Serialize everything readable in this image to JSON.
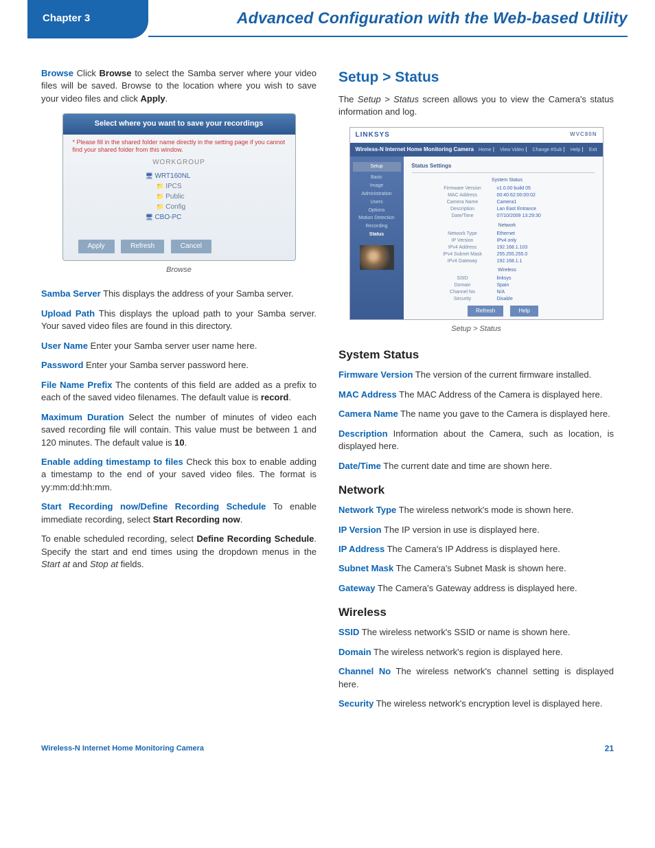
{
  "header": {
    "chapter": "Chapter 3",
    "title": "Advanced Configuration with the Web-based Utility"
  },
  "left": {
    "p1_term": "Browse",
    "p1_a": "  Click ",
    "p1_b": "Browse",
    "p1_c": " to select the Samba server where your video files will be saved. Browse to the location where you wish to save your video files and click ",
    "p1_d": "Apply",
    "p1_e": ".",
    "browse_fig": {
      "head": "Select where you want to save your recordings",
      "note": "* Please fill in the shared folder name directly in the setting page if you cannot find your shared folder from this window.",
      "group_label": "WORKGROUP",
      "node1": "WRT160NL",
      "node1a": "IPCS",
      "node1b": "Public",
      "node1c": "Config",
      "node2": "CBO-PC",
      "btn_apply": "Apply",
      "btn_refresh": "Refresh",
      "btn_cancel": "Cancel"
    },
    "cap1": "Browse",
    "p2_term": "Samba Server",
    "p2": "  This displays the address of your Samba server.",
    "p3_term": "Upload Path",
    "p3": "  This displays the upload path to your Samba server. Your saved video files are found in this directory.",
    "p4_term": "User Name",
    "p4": "  Enter your Samba server user name here.",
    "p5_term": "Password",
    "p5": "  Enter your Samba server password here.",
    "p6_term": "File Name Prefix",
    "p6a": "  The contents of this field are added as a prefix to each of the saved video filenames. The default value is ",
    "p6b": "record",
    "p6c": ".",
    "p7_term": "Maximum Duration",
    "p7a": "  Select the number of minutes of video each saved recording file will contain. This value must be between 1 and 120 minutes. The default value is ",
    "p7b": "10",
    "p7c": ".",
    "p8_term": "Enable adding timestamp to files",
    "p8": "  Check this box to enable adding a timestamp to the end of your saved video files. The format is yy:mm:dd:hh:mm.",
    "p9_term": "Start Recording now/Define Recording Schedule",
    "p9a": "  To enable immediate recording, select ",
    "p9b": "Start Recording now",
    "p9c": ".",
    "p10a": "To enable scheduled recording, select ",
    "p10b": "Define Recording Schedule",
    "p10c": ". Specify the start and end times using the dropdown menus in the ",
    "p10d": "Start at",
    "p10e": " and ",
    "p10f": "Stop at",
    "p10g": " fields."
  },
  "right": {
    "h2": "Setup > Status",
    "intro_a": "The ",
    "intro_b": "Setup > Status",
    "intro_c": " screen allows you to view the Camera's status information and log.",
    "status_fig": {
      "brand": "LINKSYS",
      "model": "WVC80N",
      "bar_title": "Wireless-N Internet Home Monitoring Camera",
      "tabs": [
        "Home",
        "View Video",
        "Change #Sub",
        "Help",
        "Exit"
      ],
      "side_btn": "Setup",
      "side": [
        "Basic",
        "Image",
        "Administration",
        "Users",
        "Options",
        "Motion Detection",
        "Recording",
        "Status"
      ],
      "section_hdr": "Status Settings",
      "s1": "System Status",
      "kv1": [
        [
          "Firmware Version",
          "v1.0.00 build 05"
        ],
        [
          "MAC Address",
          "00:40:62:00:00:02"
        ],
        [
          "Camera Name",
          "Camera1"
        ],
        [
          "Description",
          "Lan East Entrance"
        ],
        [
          "Date/Time",
          "07/10/2009  13:29:30"
        ]
      ],
      "s2": "Network",
      "kv2": [
        [
          "Network Type",
          "Ethernet"
        ],
        [
          "IP Version",
          "IPv4 only"
        ],
        [
          "IPv4 Address",
          "192.168.1.103"
        ],
        [
          "IPv4 Subnet Mask",
          "255.255.255.0"
        ],
        [
          "IPv4 Gateway",
          "192.168.1.1"
        ]
      ],
      "s3": "Wireless",
      "kv3": [
        [
          "SSID",
          "linksys"
        ],
        [
          "Domain",
          "Spain"
        ],
        [
          "Channel No",
          "N/A"
        ],
        [
          "Security",
          "Disable"
        ]
      ],
      "btn1": "Refresh",
      "btn2": "Help"
    },
    "cap2": "Setup > Status",
    "h3_1": "System Status",
    "f1_term": "Firmware Version",
    "f1": "  The version of the current firmware installed.",
    "f2_term": "MAC Address",
    "f2": "  The MAC Address of the Camera is displayed here.",
    "f3_term": "Camera Name",
    "f3": "  The name you gave to the Camera is displayed here.",
    "f4_term": "Description",
    "f4": "  Information about the Camera, such as location, is displayed here.",
    "f5_term": "Date/Time",
    "f5": "  The current date and time are shown here.",
    "h3_2": "Network",
    "n1_term": "Network Type",
    "n1": "  The wireless network's mode is shown here.",
    "n2_term": "IP Version",
    "n2": "  The IP version in use is displayed here.",
    "n3_term": "IP Address",
    "n3": "  The Camera's IP Address is displayed here.",
    "n4_term": "Subnet Mask",
    "n4": "  The Camera's Subnet Mask is shown here.",
    "n5_term": "Gateway",
    "n5": "  The Camera's Gateway address is displayed here.",
    "h3_3": "Wireless",
    "w1_term": "SSID",
    "w1": "  The wireless network's SSID or name is shown here.",
    "w2_term": "Domain",
    "w2": "  The wireless network's region is displayed here.",
    "w3_term": "Channel No",
    "w3": "  The wireless network's channel setting is displayed here.",
    "w4_term": "Security",
    "w4": "  The wireless network's encryption level is displayed here."
  },
  "footer": {
    "left": "Wireless-N Internet Home Monitoring Camera",
    "right": "21"
  }
}
